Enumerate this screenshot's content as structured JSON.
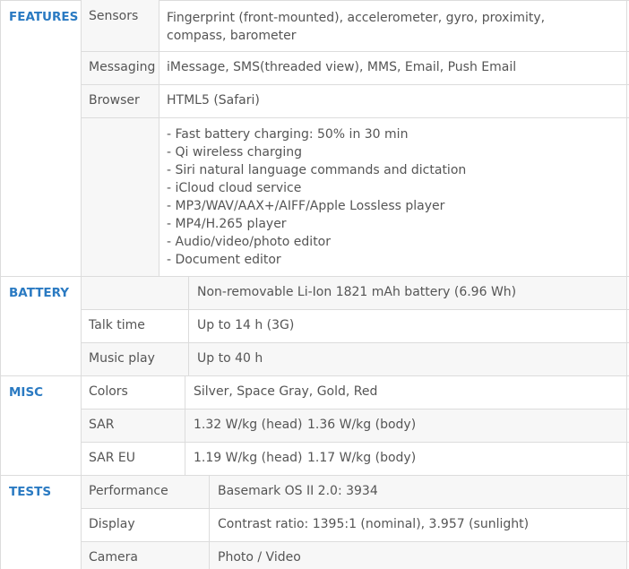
{
  "features": {
    "category": "FEATURES",
    "rows": [
      {
        "label": "Sensors",
        "value": "Fingerprint (front-mounted), accelerometer, gyro, proximity, compass, barometer"
      },
      {
        "label": "Messaging",
        "value": "iMessage, SMS(threaded view), MMS, Email, Push Email"
      },
      {
        "label": "Browser",
        "value": "HTML5 (Safari)"
      },
      {
        "label": "",
        "bullets": [
          "- Fast battery charging: 50% in 30 min",
          "- Qi wireless charging",
          "- Siri natural language commands and dictation",
          "- iCloud cloud service",
          "- MP3/WAV/AAX+/AIFF/Apple Lossless player",
          "- MP4/H.265 player",
          "- Audio/video/photo editor",
          "- Document editor"
        ]
      }
    ]
  },
  "battery": {
    "category": "BATTERY",
    "rows": [
      {
        "label": "",
        "value": "Non-removable Li-Ion 1821 mAh battery (6.96 Wh)"
      },
      {
        "label": "Talk time",
        "value": "Up to 14 h (3G)"
      },
      {
        "label": "Music play",
        "value": "Up to 40 h"
      }
    ]
  },
  "misc": {
    "category": "MISC",
    "rows": [
      {
        "label": "Colors",
        "value": "Silver, Space Gray, Gold, Red"
      },
      {
        "label": "SAR",
        "value_a": "1.32 W/kg (head)",
        "value_b": "1.36 W/kg (body)"
      },
      {
        "label": "SAR EU",
        "value_a": "1.19 W/kg (head)",
        "value_b": "1.17 W/kg (body)"
      }
    ]
  },
  "tests": {
    "category": "TESTS",
    "rows": [
      {
        "label": "Performance",
        "value": "Basemark OS II 2.0: 3934"
      },
      {
        "label": "Display",
        "value": "Contrast ratio: 1395:1 (nominal), 3.957 (sunlight)"
      },
      {
        "label": "Camera",
        "value": "Photo / Video"
      }
    ]
  }
}
